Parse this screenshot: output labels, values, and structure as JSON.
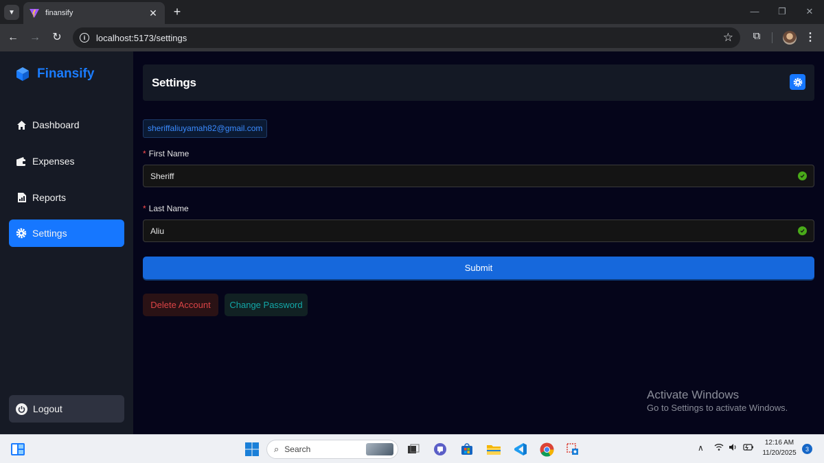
{
  "browser": {
    "tab_title": "finansify",
    "url": "localhost:5173/settings",
    "new_tab_label": "+",
    "close_tab_label": "✕"
  },
  "sidebar": {
    "brand": "Finansify",
    "items": [
      {
        "label": "Dashboard",
        "icon": "home-icon",
        "active": false
      },
      {
        "label": "Expenses",
        "icon": "wallet-icon",
        "active": false
      },
      {
        "label": "Reports",
        "icon": "report-icon",
        "active": false
      },
      {
        "label": "Settings",
        "icon": "gear-icon",
        "active": true
      }
    ],
    "logout_label": "Logout"
  },
  "header": {
    "title": "Settings"
  },
  "form": {
    "email": "sheriffaliuyamah82@gmail.com",
    "first_name_label": "First Name",
    "first_name_value": "Sheriff",
    "last_name_label": "Last Name",
    "last_name_value": "Aliu",
    "required_mark": "*",
    "submit_label": "Submit",
    "delete_label": "Delete Account",
    "change_password_label": "Change Password"
  },
  "watermark": {
    "title": "Activate Windows",
    "subtitle": "Go to Settings to activate Windows."
  },
  "taskbar": {
    "search_placeholder": "Search",
    "time": "12:16 AM",
    "date": "11/20/2025",
    "notification_count": "3"
  },
  "colors": {
    "accent": "#1677ff",
    "brand": "#1a7cff",
    "danger": "#dc4446",
    "teal": "#13a8a8",
    "success": "#49aa19"
  }
}
